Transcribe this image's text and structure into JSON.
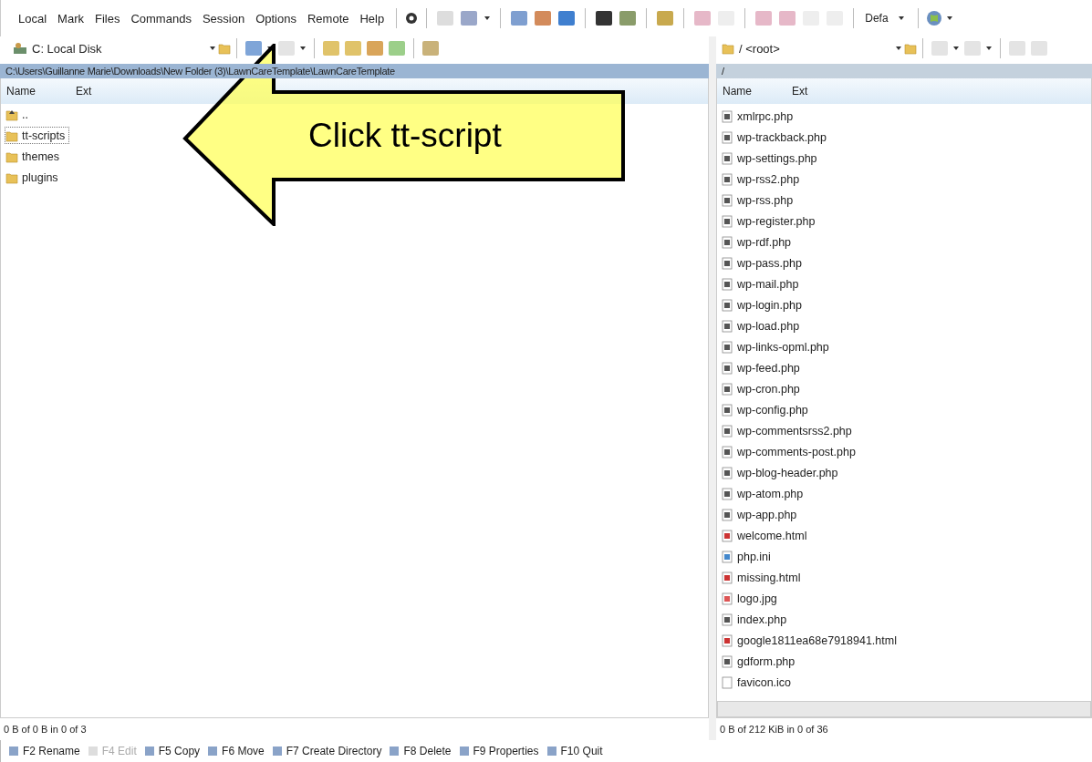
{
  "menu": [
    "Local",
    "Mark",
    "Files",
    "Commands",
    "Session",
    "Options",
    "Remote",
    "Help"
  ],
  "toolbar": {
    "preset": "Defa"
  },
  "left_pane": {
    "drive": "C: Local Disk",
    "path": "C:\\Users\\Guillanne Marie\\Downloads\\New Folder (3)\\LawnCareTemplate\\LawnCareTemplate",
    "columns": [
      "Name",
      "Ext"
    ],
    "rows": [
      {
        "kind": "parent",
        "name": "..",
        "focused": false
      },
      {
        "kind": "folder",
        "name": "tt-scripts",
        "focused": true
      },
      {
        "kind": "folder",
        "name": "themes",
        "focused": false
      },
      {
        "kind": "folder",
        "name": "plugins",
        "focused": false
      }
    ],
    "status": "0 B of 0 B in 0 of 3"
  },
  "right_pane": {
    "drive": "/ <root>",
    "path": "/",
    "columns": [
      "Name",
      "Ext"
    ],
    "files": [
      {
        "kind": "php",
        "name": "xmlrpc.php"
      },
      {
        "kind": "php",
        "name": "wp-trackback.php"
      },
      {
        "kind": "php",
        "name": "wp-settings.php"
      },
      {
        "kind": "php",
        "name": "wp-rss2.php"
      },
      {
        "kind": "php",
        "name": "wp-rss.php"
      },
      {
        "kind": "php",
        "name": "wp-register.php"
      },
      {
        "kind": "php",
        "name": "wp-rdf.php"
      },
      {
        "kind": "php",
        "name": "wp-pass.php"
      },
      {
        "kind": "php",
        "name": "wp-mail.php"
      },
      {
        "kind": "php",
        "name": "wp-login.php"
      },
      {
        "kind": "php",
        "name": "wp-load.php"
      },
      {
        "kind": "php",
        "name": "wp-links-opml.php"
      },
      {
        "kind": "php",
        "name": "wp-feed.php"
      },
      {
        "kind": "php",
        "name": "wp-cron.php"
      },
      {
        "kind": "php",
        "name": "wp-config.php"
      },
      {
        "kind": "php",
        "name": "wp-commentsrss2.php"
      },
      {
        "kind": "php",
        "name": "wp-comments-post.php"
      },
      {
        "kind": "php",
        "name": "wp-blog-header.php"
      },
      {
        "kind": "php",
        "name": "wp-atom.php"
      },
      {
        "kind": "php",
        "name": "wp-app.php"
      },
      {
        "kind": "html",
        "name": "welcome.html"
      },
      {
        "kind": "ini",
        "name": "php.ini"
      },
      {
        "kind": "html",
        "name": "missing.html"
      },
      {
        "kind": "image",
        "name": "logo.jpg"
      },
      {
        "kind": "php",
        "name": "index.php"
      },
      {
        "kind": "html",
        "name": "google1811ea68e7918941.html"
      },
      {
        "kind": "php",
        "name": "gdform.php"
      },
      {
        "kind": "blank",
        "name": "favicon.ico"
      }
    ],
    "status": "0 B of 212 KiB in 0 of 36"
  },
  "function_keys": [
    {
      "label": "F2 Rename",
      "disabled": false
    },
    {
      "label": "F4 Edit",
      "disabled": true
    },
    {
      "label": "F5 Copy",
      "disabled": false
    },
    {
      "label": "F6 Move",
      "disabled": false
    },
    {
      "label": "F7 Create Directory",
      "disabled": false
    },
    {
      "label": "F8 Delete",
      "disabled": false
    },
    {
      "label": "F9 Properties",
      "disabled": false
    },
    {
      "label": "F10 Quit",
      "disabled": false
    }
  ],
  "callout": {
    "text": "Click tt-script"
  }
}
